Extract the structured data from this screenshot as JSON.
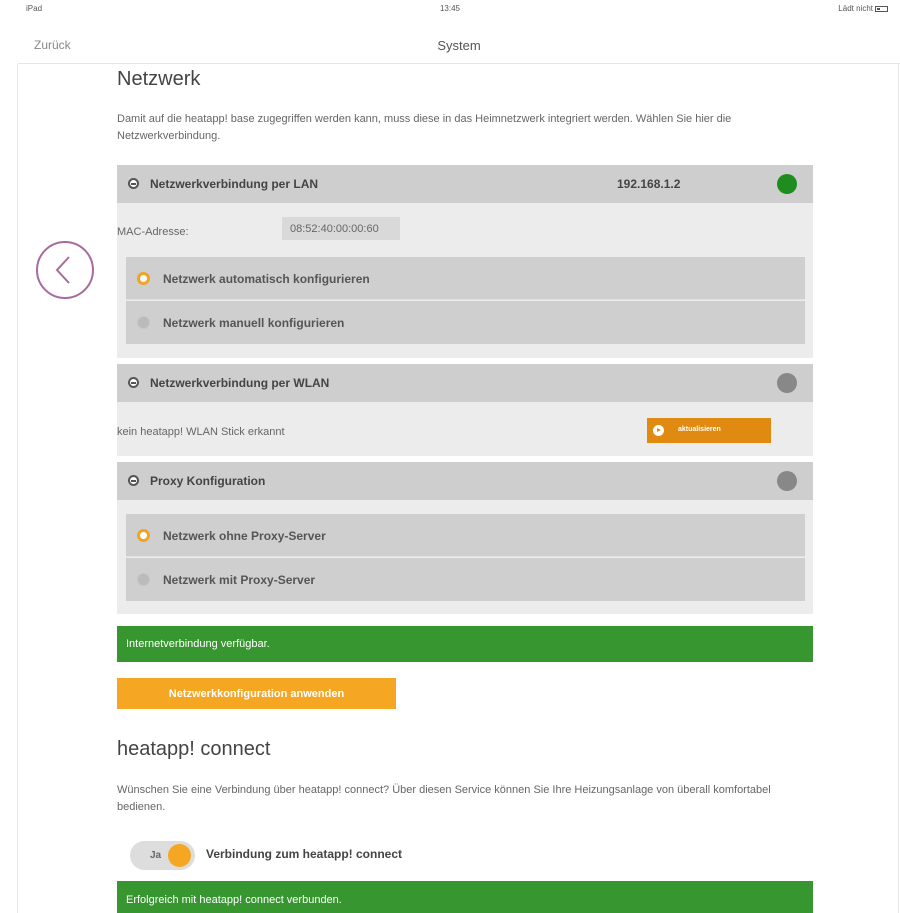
{
  "status_bar": {
    "device": "iPad",
    "time": "13:45",
    "battery_text": "Lädt nicht"
  },
  "nav": {
    "back_label": "Zurück",
    "title": "System"
  },
  "network": {
    "heading": "Netzwerk",
    "description": "Damit auf die heatapp! base zugegriffen werden kann, muss diese in das Heimnetzwerk integriert werden. Wählen Sie hier die Netzwerkverbindung.",
    "lan": {
      "label": "Netzwerkverbindung per LAN",
      "ip": "192.168.1.2",
      "status_color": "#1e8c1e",
      "mac_label": "MAC-Adresse:",
      "mac_value": "08:52:40:00:00:60",
      "options": [
        {
          "label": "Netzwerk automatisch konfigurieren",
          "selected": true
        },
        {
          "label": "Netzwerk manuell konfigurieren",
          "selected": false
        }
      ]
    },
    "wlan": {
      "label": "Netzwerkverbindung per WLAN",
      "status_color": "#888888",
      "message": "kein heatapp! WLAN Stick erkannt",
      "update_label": "aktualisieren"
    },
    "proxy": {
      "label": "Proxy Konfiguration",
      "status_color": "#888888",
      "options": [
        {
          "label": "Netzwerk ohne Proxy-Server",
          "selected": true
        },
        {
          "label": "Netzwerk mit Proxy-Server",
          "selected": false
        }
      ]
    },
    "internet_status": "Internetverbindung verfügbar.",
    "apply_label": "Netzwerkkonfiguration anwenden"
  },
  "connect": {
    "heading": "heatapp! connect",
    "description": "Wünschen Sie eine Verbindung über heatapp! connect? Über diesen Service können Sie Ihre Heizungsanlage von überall komfortabel bedienen.",
    "toggle_label": "Ja",
    "toggle_on": true,
    "connection_label": "Verbindung zum heatapp! connect",
    "status": "Erfolgreich mit heatapp! connect verbunden."
  },
  "colors": {
    "accent": "#f5a623",
    "success": "#37962f",
    "back_circle": "#a76b9c"
  }
}
